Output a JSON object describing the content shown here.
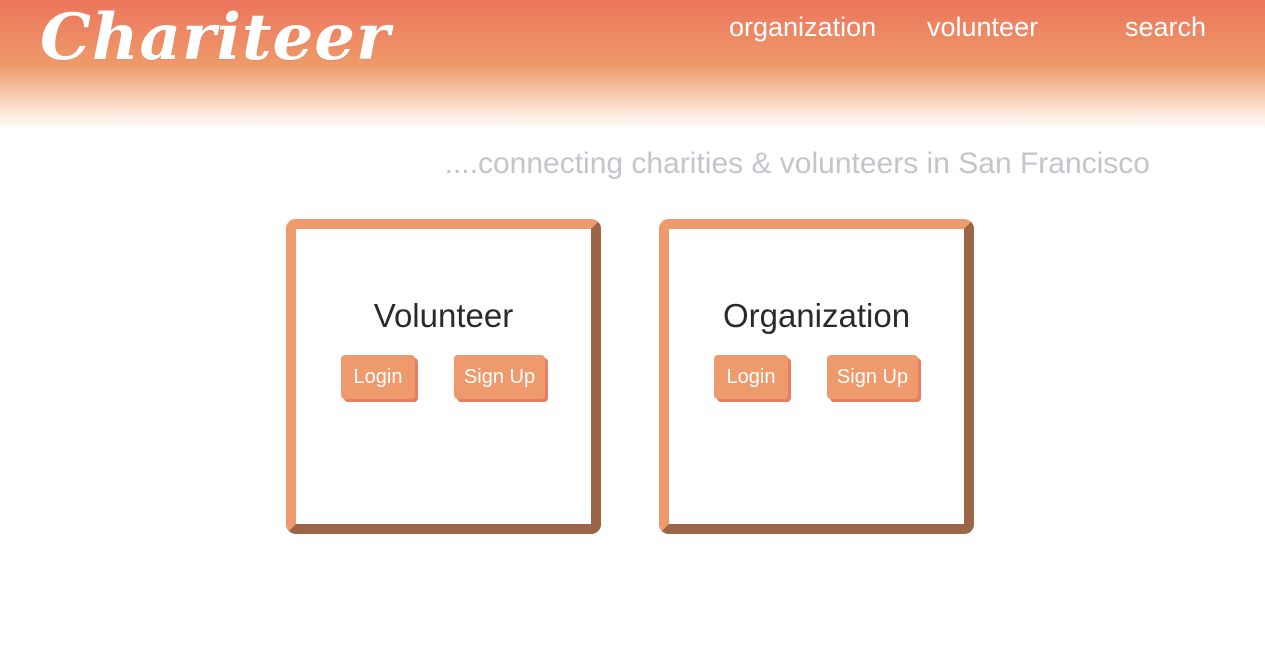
{
  "header": {
    "logo": "Chariteer",
    "nav": {
      "organization": "organization",
      "volunteer": "volunteer",
      "search": "search"
    }
  },
  "tagline": "....connecting charities & volunteers in San Francisco",
  "cards": {
    "volunteer": {
      "title": "Volunteer",
      "login_label": "Login",
      "signup_label": "Sign Up"
    },
    "organization": {
      "title": "Organization",
      "login_label": "Login",
      "signup_label": "Sign Up"
    }
  },
  "colors": {
    "accent": "#ee9a6c",
    "accent_dark": "#9b6647",
    "header_top": "#ec755c",
    "tagline": "#c2c5cb"
  }
}
